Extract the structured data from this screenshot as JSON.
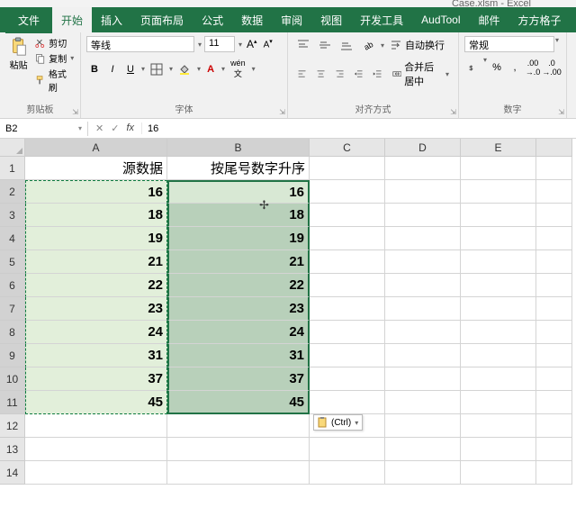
{
  "titlebar": {
    "filename": "Case.xlsm - Excel"
  },
  "tabs": {
    "file": "文件",
    "items": [
      "开始",
      "插入",
      "页面布局",
      "公式",
      "数据",
      "审阅",
      "视图",
      "开发工具",
      "AudTool",
      "邮件",
      "方方格子"
    ],
    "active_index": 0
  },
  "ribbon": {
    "clipboard": {
      "label": "剪贴板",
      "paste": "粘贴",
      "cut": "剪切",
      "copy": "复制",
      "format_painter": "格式刷"
    },
    "font": {
      "label": "字体",
      "font_name": "等线",
      "font_size": "11",
      "increase": "A",
      "decrease": "A"
    },
    "alignment": {
      "label": "对齐方式",
      "wrap": "自动换行",
      "merge": "合并后居中"
    },
    "number": {
      "label": "数字",
      "format": "常规"
    }
  },
  "namebox": "B2",
  "formula": "16",
  "paste_options_label": "(Ctrl)",
  "grid": {
    "columns": [
      "A",
      "B",
      "C",
      "D",
      "E"
    ],
    "row_headers": [
      1,
      2,
      3,
      4,
      5,
      6,
      7,
      8,
      9,
      10,
      11,
      12,
      13,
      14
    ],
    "header_row": {
      "A": "源数据",
      "B": "按尾号数字升序"
    },
    "data": [
      {
        "A": 16,
        "B": 16
      },
      {
        "A": 18,
        "B": 18
      },
      {
        "A": 19,
        "B": 19
      },
      {
        "A": 21,
        "B": 21
      },
      {
        "A": 22,
        "B": 22
      },
      {
        "A": 23,
        "B": 23
      },
      {
        "A": 24,
        "B": 24
      },
      {
        "A": 31,
        "B": 31
      },
      {
        "A": 37,
        "B": 37
      },
      {
        "A": 45,
        "B": 45
      }
    ]
  }
}
